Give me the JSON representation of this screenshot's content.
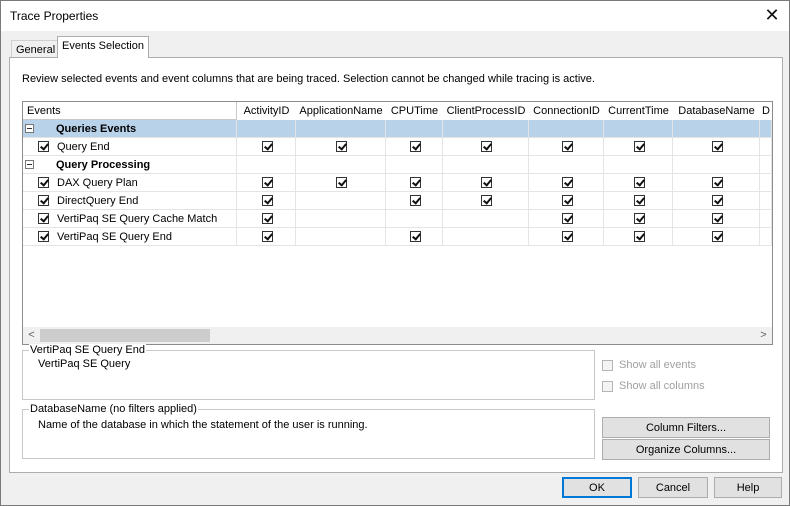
{
  "window": {
    "title": "Trace Properties"
  },
  "tabs": [
    {
      "label": "General"
    },
    {
      "label": "Events Selection"
    }
  ],
  "description": "Review selected events and event columns that are being traced. Selection cannot be changed while tracing is active.",
  "grid": {
    "columns": [
      "Events",
      "ActivityID",
      "ApplicationName",
      "CPUTime",
      "ClientProcessID",
      "ConnectionID",
      "CurrentTime",
      "DatabaseName",
      "D"
    ],
    "rows": [
      {
        "type": "category",
        "label": "Queries Events",
        "selected": true,
        "checks": [
          false,
          false,
          false,
          false,
          false,
          false,
          false,
          false
        ]
      },
      {
        "type": "event",
        "label": "Query End",
        "checks": [
          true,
          true,
          true,
          true,
          true,
          true,
          true,
          false
        ]
      },
      {
        "type": "category",
        "label": "Query Processing",
        "selected": false,
        "checks": [
          false,
          false,
          false,
          false,
          false,
          false,
          false,
          false
        ]
      },
      {
        "type": "event",
        "label": "DAX Query Plan",
        "checks": [
          true,
          true,
          true,
          true,
          true,
          true,
          true,
          false
        ]
      },
      {
        "type": "event",
        "label": "DirectQuery End",
        "checks": [
          true,
          false,
          true,
          true,
          true,
          true,
          true,
          false
        ]
      },
      {
        "type": "event",
        "label": "VertiPaq SE Query Cache Match",
        "checks": [
          true,
          false,
          false,
          false,
          true,
          true,
          true,
          false
        ]
      },
      {
        "type": "event",
        "label": "VertiPaq SE Query End",
        "checks": [
          true,
          false,
          true,
          false,
          true,
          true,
          true,
          false
        ]
      }
    ]
  },
  "event_info": {
    "title": "VertiPaq SE Query End",
    "text": "VertiPaq SE Query"
  },
  "column_info": {
    "title": "DatabaseName (no filters applied)",
    "text": "Name of the database in which the statement of the user is running."
  },
  "options": {
    "show_all_events": "Show all events",
    "show_all_columns": "Show all columns"
  },
  "buttons": {
    "column_filters": "Column Filters...",
    "organize_columns": "Organize Columns...",
    "ok": "OK",
    "cancel": "Cancel",
    "help": "Help"
  }
}
